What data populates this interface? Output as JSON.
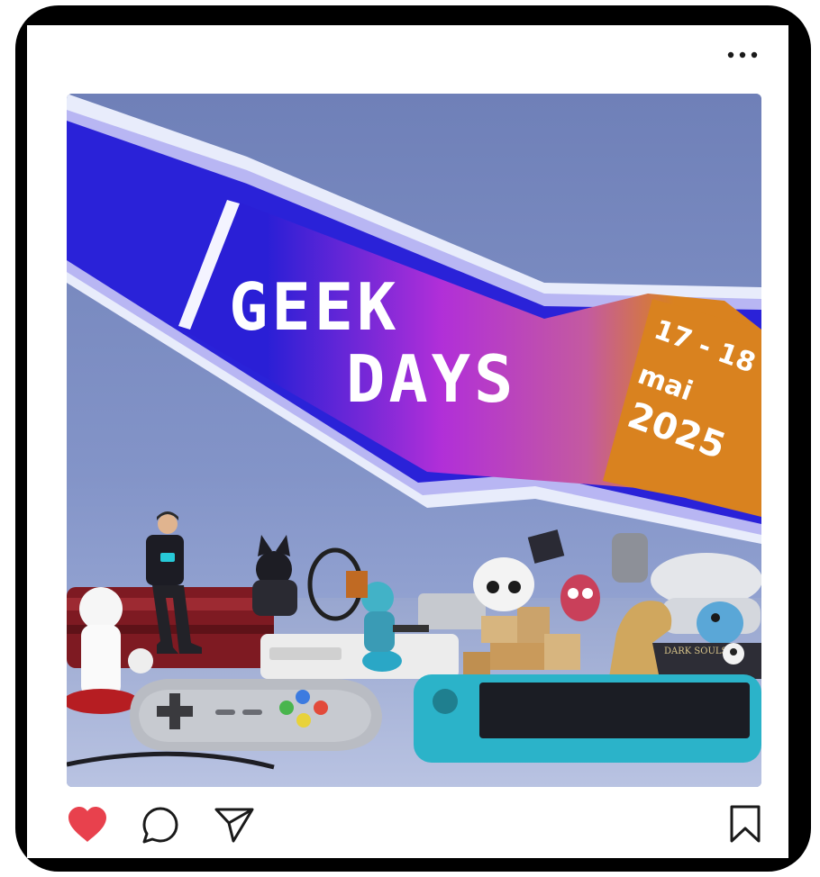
{
  "post": {
    "title_line1": "GEEK",
    "title_line2": "DAYS",
    "date_days": "17 - 18",
    "date_month": "mai",
    "date_year": "2025",
    "book_spine_text": "DARK SOULS III"
  },
  "colors": {
    "frame": "#000000",
    "background_sky": "#8a9acb",
    "banner_blue": "#2a1fd6",
    "banner_purple": "#b12fd8",
    "banner_orange": "#d9821f",
    "like_red": "#e8414d",
    "icon_stroke": "#1a1a1a"
  },
  "actions": {
    "like": "heart-icon",
    "comment": "comment-icon",
    "share": "paper-plane-icon",
    "save": "bookmark-icon",
    "liked": true
  }
}
